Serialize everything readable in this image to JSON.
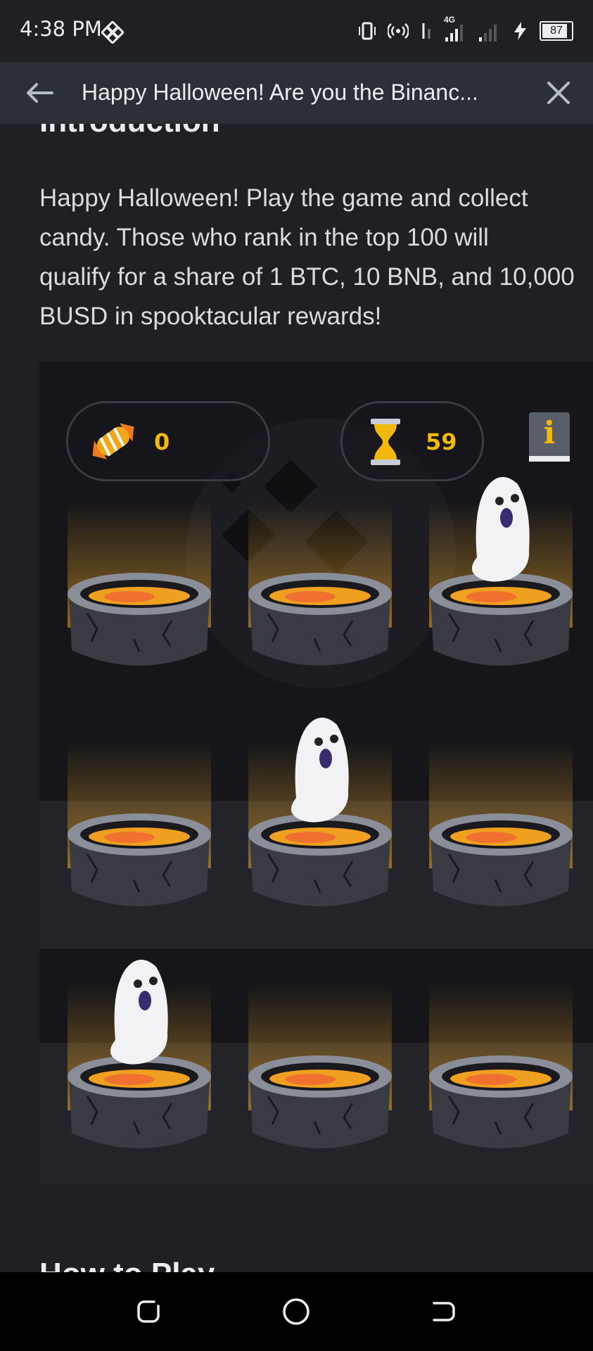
{
  "status_bar": {
    "time": "4:38 PM",
    "network": "4G",
    "battery": "87",
    "battery_level": 0.87,
    "icons": [
      "binance-logo-icon",
      "vibrate-icon",
      "hotspot-icon",
      "data-arrows-icon",
      "signal-icon",
      "signal-icon",
      "charging-icon",
      "battery-icon"
    ]
  },
  "app_bar": {
    "title": "Happy Halloween! Are you the Binanc...",
    "back_icon": "arrow-left-icon",
    "close_icon": "close-icon"
  },
  "content": {
    "intro_heading": "Introduction",
    "intro_text": "Happy Halloween! Play the game and collect\ncandy. Those who rank in the top 100 will\nqualify for a share of 1 BTC, 10 BNB, and 10,000\nBUSD in spooktacular rewards!",
    "next_heading": "How to Play"
  },
  "game": {
    "candy_count": "0",
    "timer": "59",
    "info_label": "i",
    "icons": [
      "candy-icon",
      "hourglass-icon",
      "info-book-icon"
    ],
    "grid": {
      "rows": 3,
      "cols": 3
    },
    "ghosts": [
      {
        "row": 0,
        "col": 2
      },
      {
        "row": 1,
        "col": 1
      },
      {
        "row": 2,
        "col": 0
      }
    ]
  },
  "nav_bar": {
    "icons": [
      "recent-apps-icon",
      "home-icon",
      "back-icon"
    ]
  },
  "colors": {
    "background": "#1f2026",
    "app_bar": "#2b2f36",
    "accent": "#f0b90b",
    "text": "#eaecef"
  }
}
